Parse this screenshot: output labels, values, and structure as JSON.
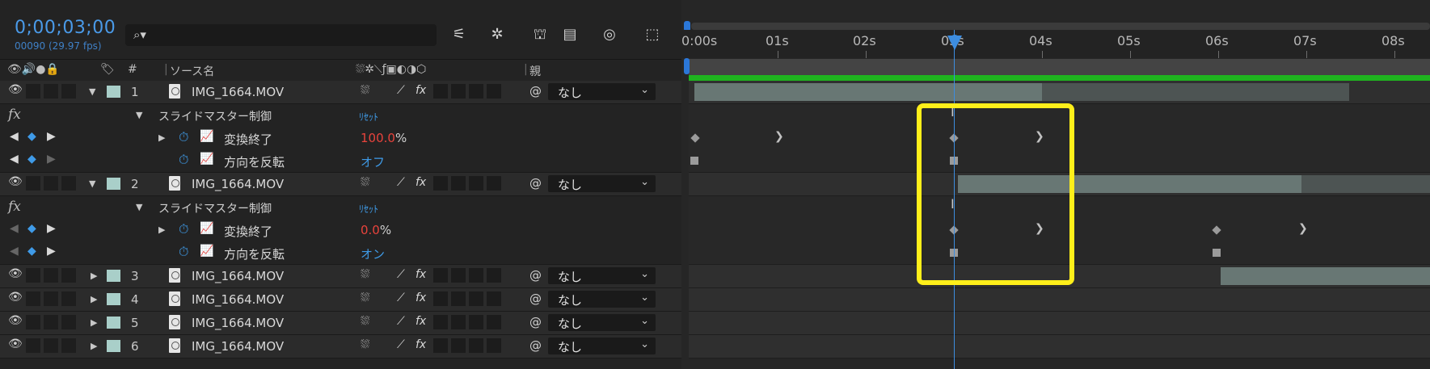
{
  "comp": {
    "timecode": "0;00;03;00",
    "fps_info": "00090 (29.97 fps)",
    "search_placeholder": ""
  },
  "toolbar": {
    "icons": [
      "comp-flowchart-icon",
      "draft-3d-icon",
      "shy-layers-icon",
      "frame-blending-icon",
      "motion-blur-icon",
      "graph-editor-icon"
    ]
  },
  "columns": {
    "label_hash": "#",
    "source_name": "ソース名",
    "parent": "親"
  },
  "ruler": {
    "labels": [
      "0:00s",
      "01s",
      "02s",
      "03s",
      "04s",
      "05s",
      "06s",
      "07s",
      "08s"
    ]
  },
  "rows": {
    "l1": {
      "num": "1",
      "name": "IMG_1664.MOV",
      "parent": "なし"
    },
    "e1": {
      "fx": "fx",
      "name": "スライドマスター制御",
      "reset": "ﾘｾｯﾄ"
    },
    "p1a": {
      "name": "変換終了",
      "value": "100.0",
      "unit": "%"
    },
    "p1b": {
      "name": "方向を反転",
      "value": "オフ"
    },
    "l2": {
      "num": "2",
      "name": "IMG_1664.MOV",
      "parent": "なし"
    },
    "e2": {
      "fx": "fx",
      "name": "スライドマスター制御",
      "reset": "ﾘｾｯﾄ"
    },
    "p2a": {
      "name": "変換終了",
      "value": "0.0",
      "unit": "%"
    },
    "p2b": {
      "name": "方向を反転",
      "value": "オン"
    },
    "l3": {
      "num": "3",
      "name": "IMG_1664.MOV",
      "parent": "なし"
    },
    "l4": {
      "num": "4",
      "name": "IMG_1664.MOV",
      "parent": "なし"
    },
    "l5": {
      "num": "5",
      "name": "IMG_1664.MOV",
      "parent": "なし"
    },
    "l6": {
      "num": "6",
      "name": "IMG_1664.MOV",
      "parent": "なし"
    }
  },
  "colors": {
    "accent": "#3d8de0",
    "highlight": "#ffef1a",
    "label": "#a9cfc9",
    "value_red": "#e8433c",
    "work_area_green": "#1fb41f"
  }
}
